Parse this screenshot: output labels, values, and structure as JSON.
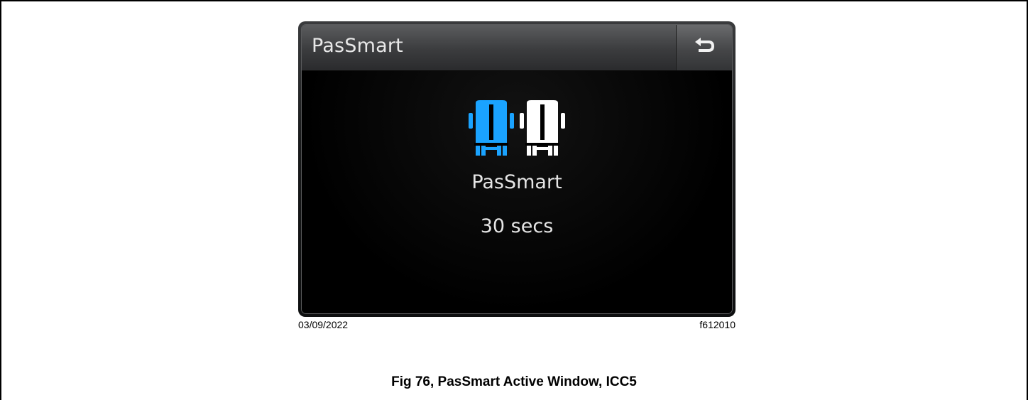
{
  "screen": {
    "header": {
      "title": "PasSmart",
      "back_icon": "back-arrow-icon"
    },
    "icons": [
      {
        "name": "truck-front-icon-active",
        "color": "#1aa3ff"
      },
      {
        "name": "truck-front-icon",
        "color": "#ffffff"
      }
    ],
    "status": {
      "label": "PasSmart",
      "value": "30 secs"
    }
  },
  "figure": {
    "date": "03/09/2022",
    "code": "f612010",
    "caption": "Fig 76, PasSmart Active Window, ICC5"
  }
}
